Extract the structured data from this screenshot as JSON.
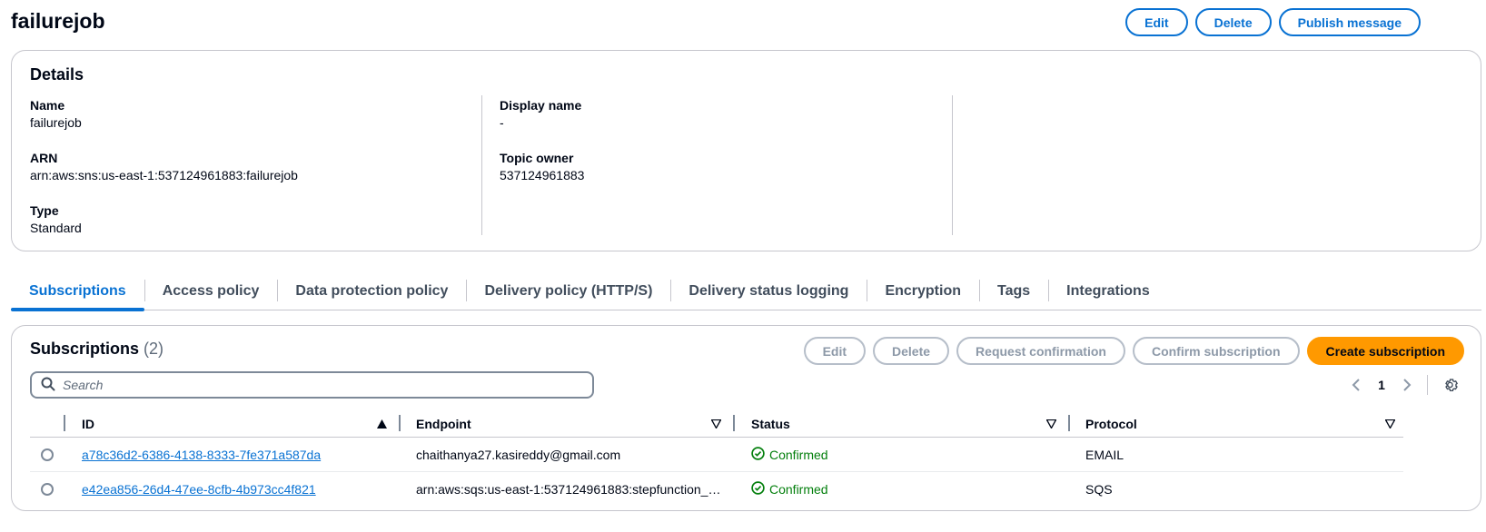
{
  "topic": {
    "title": "failurejob",
    "actions": {
      "edit": "Edit",
      "delete": "Delete",
      "publish": "Publish message"
    }
  },
  "details": {
    "heading": "Details",
    "fields": {
      "name_label": "Name",
      "name_value": "failurejob",
      "arn_label": "ARN",
      "arn_value": "arn:aws:sns:us-east-1:537124961883:failurejob",
      "type_label": "Type",
      "type_value": "Standard",
      "display_name_label": "Display name",
      "display_name_value": "-",
      "owner_label": "Topic owner",
      "owner_value": "537124961883"
    }
  },
  "tabs": [
    {
      "label": "Subscriptions",
      "active": true
    },
    {
      "label": "Access policy"
    },
    {
      "label": "Data protection policy"
    },
    {
      "label": "Delivery policy (HTTP/S)"
    },
    {
      "label": "Delivery status logging"
    },
    {
      "label": "Encryption"
    },
    {
      "label": "Tags"
    },
    {
      "label": "Integrations"
    }
  ],
  "subscriptions": {
    "heading": "Subscriptions",
    "count": "(2)",
    "actions": {
      "edit": "Edit",
      "delete": "Delete",
      "request_confirmation": "Request confirmation",
      "confirm_subscription": "Confirm subscription",
      "create_subscription": "Create subscription"
    },
    "search_placeholder": "Search",
    "pagination": {
      "current_page": "1"
    },
    "columns": {
      "id": "ID",
      "endpoint": "Endpoint",
      "status": "Status",
      "protocol": "Protocol"
    },
    "rows": [
      {
        "id": "a78c36d2-6386-4138-8333-7fe371a587da",
        "endpoint": "chaithanya27.kasireddy@gmail.com",
        "status": "Confirmed",
        "protocol": "EMAIL"
      },
      {
        "id": "e42ea856-26d4-47ee-8cfb-4b973cc4f821",
        "endpoint": "arn:aws:sqs:us-east-1:537124961883:stepfunction_…",
        "status": "Confirmed",
        "protocol": "SQS"
      }
    ]
  },
  "colors": {
    "accent": "#0972d3",
    "primary_button": "#ff9900",
    "success": "#037f0c",
    "disabled": "#8d99a8"
  }
}
